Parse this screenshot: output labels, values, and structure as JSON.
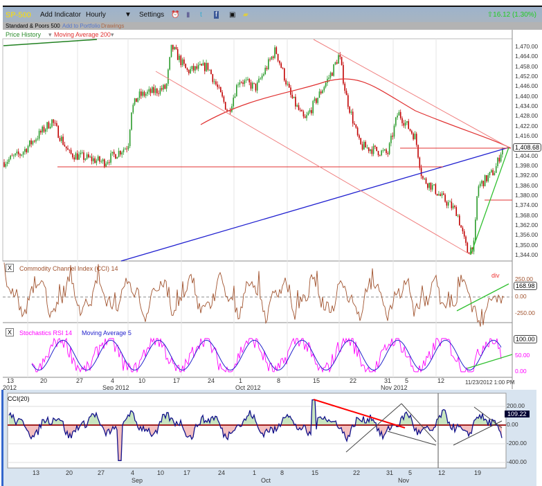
{
  "toolbar": {
    "symbol": "SP-500",
    "add_indicator": "Add Indicator",
    "interval": "Hourly",
    "settings": "Settings",
    "change": "16.12 (1.30%)",
    "icons": [
      "alarm-icon",
      "books-icon",
      "twitter-icon",
      "facebook-icon",
      "camera-icon",
      "note-icon"
    ]
  },
  "subbar": {
    "name": "Standard & Poors 500",
    "add_portfolio": "Add to Portfolio",
    "drawings": "Drawings"
  },
  "price_panel": {
    "legend1": "Price History",
    "legend2": "Moving Average 200",
    "last": "1,408.68",
    "ticks": [
      "1,470.00",
      "1,464.00",
      "1,458.00",
      "1,452.00",
      "1,446.00",
      "1,440.00",
      "1,434.00",
      "1,428.00",
      "1,422.00",
      "1,416.00",
      "1,410.00",
      "1,404.00",
      "1,398.00",
      "1,392.00",
      "1,386.00",
      "1,380.00",
      "1,374.00",
      "1,368.00",
      "1,362.00",
      "1,356.00",
      "1,350.00",
      "1,344.00"
    ]
  },
  "cci_panel": {
    "legend": "Commodity Channel Index (CCI) 14",
    "last": "168.98",
    "annotation": "div",
    "ticks": [
      "250.00",
      "0.00",
      "-250.00"
    ]
  },
  "stoch_panel": {
    "legend1": "Stochastics RSI 14",
    "legend2": "Moving Average 5",
    "last": "100.00",
    "ticks": [
      "50.00",
      "0.00"
    ]
  },
  "date_axis": {
    "days": [
      "13",
      "20",
      "27",
      "4",
      "10",
      "17",
      "24",
      "1",
      "8",
      "15",
      "22",
      "31",
      "5",
      "12"
    ],
    "months": [
      "2012",
      "Sep 2012",
      "Oct 2012",
      "Nov 2012"
    ],
    "timestamp": "11/23/2012 1:00 PM"
  },
  "bottom_chart": {
    "title": "CCI(20)",
    "last": "109.22",
    "ticks": [
      "200.00",
      "0.00",
      "-200.00",
      "-400.00"
    ],
    "days": [
      "13",
      "20",
      "27",
      "4",
      "10",
      "17",
      "24",
      "1",
      "8",
      "15",
      "22",
      "31",
      "5",
      "12",
      "19"
    ],
    "months": [
      "Sep",
      "Oct",
      "Nov"
    ]
  },
  "colors": {
    "up": "#2a9a2a",
    "down": "#c00000",
    "ma": "#e03030",
    "blue": "#2020d0",
    "cci": "#a0522d",
    "stoch": "#ff00ff"
  }
}
